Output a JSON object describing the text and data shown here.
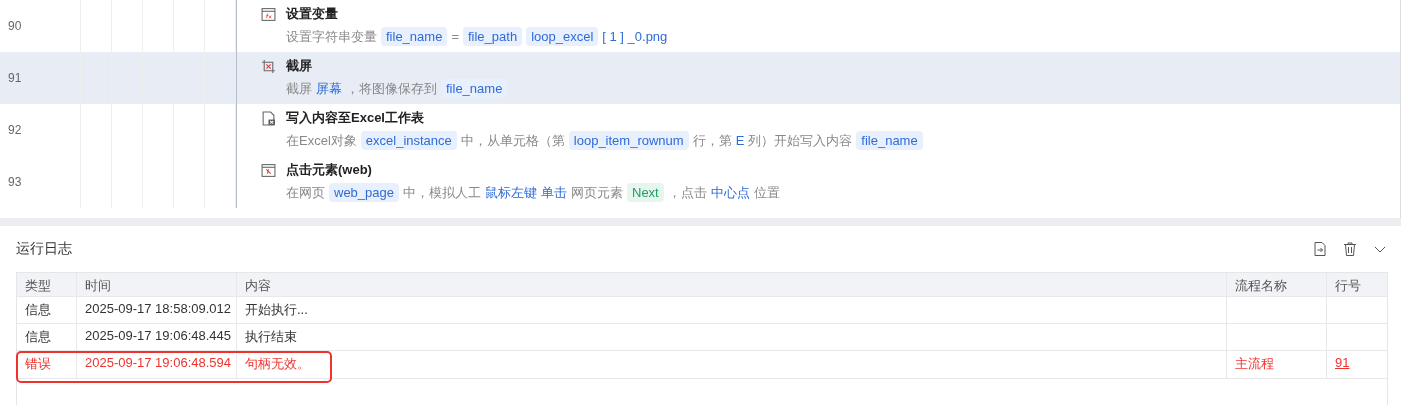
{
  "flow": {
    "steps": [
      {
        "line": "90",
        "kind": "variable",
        "title": "设置变量",
        "selected": false,
        "parts": [
          {
            "kind": "text",
            "text": "设置字符串变量"
          },
          {
            "kind": "var",
            "text": "file_name"
          },
          {
            "kind": "text",
            "text": "="
          },
          {
            "kind": "var",
            "text": "file_path"
          },
          {
            "kind": "var",
            "text": "loop_excel"
          },
          {
            "kind": "kw",
            "text": "[ 1 ] _0.png"
          }
        ]
      },
      {
        "line": "91",
        "kind": "screenshot",
        "title": "截屏",
        "selected": true,
        "parts": [
          {
            "kind": "text",
            "text": "截屏"
          },
          {
            "kind": "kw",
            "text": "屏幕"
          },
          {
            "kind": "text",
            "text": "，将图像保存到"
          },
          {
            "kind": "var",
            "text": "file_name"
          }
        ]
      },
      {
        "line": "92",
        "kind": "excel",
        "title": "写入内容至Excel工作表",
        "selected": false,
        "parts": [
          {
            "kind": "text",
            "text": "在Excel对象"
          },
          {
            "kind": "var",
            "text": "excel_instance"
          },
          {
            "kind": "text",
            "text": "中，从单元格（第"
          },
          {
            "kind": "var",
            "text": "loop_item_rownum"
          },
          {
            "kind": "text",
            "text": "行，第"
          },
          {
            "kind": "kw",
            "text": "E"
          },
          {
            "kind": "text",
            "text": "列）开始写入内容"
          },
          {
            "kind": "var",
            "text": "file_name"
          }
        ]
      },
      {
        "line": "93",
        "kind": "click",
        "title": "点击元素(web)",
        "selected": false,
        "parts": [
          {
            "kind": "text",
            "text": "在网页"
          },
          {
            "kind": "var",
            "text": "web_page"
          },
          {
            "kind": "text",
            "text": "中，模拟人工"
          },
          {
            "kind": "kw",
            "text": "鼠标左键"
          },
          {
            "kind": "kw",
            "text": "单击"
          },
          {
            "kind": "text",
            "text": "网页元素"
          },
          {
            "kind": "elem",
            "text": "Next"
          },
          {
            "kind": "text",
            "text": "，点击"
          },
          {
            "kind": "kw",
            "text": "中心点"
          },
          {
            "kind": "text",
            "text": "位置"
          }
        ]
      }
    ]
  },
  "log": {
    "title": "运行日志",
    "columns": [
      "类型",
      "时间",
      "内容",
      "流程名称",
      "行号"
    ],
    "rows": [
      {
        "kind": "info",
        "outlined": false,
        "type": "信息",
        "time": "2025-09-17 18:58:09.012",
        "content": "开始执行..."
      },
      {
        "kind": "info",
        "outlined": false,
        "type": "信息",
        "time": "2025-09-17 19:06:48.445",
        "content": "执行结束"
      },
      {
        "kind": "error",
        "outlined": true,
        "type": "错误",
        "time": "2025-09-17 19:06:48.594",
        "content": "句柄无效。",
        "flow": "主流程",
        "line": "91"
      }
    ]
  }
}
